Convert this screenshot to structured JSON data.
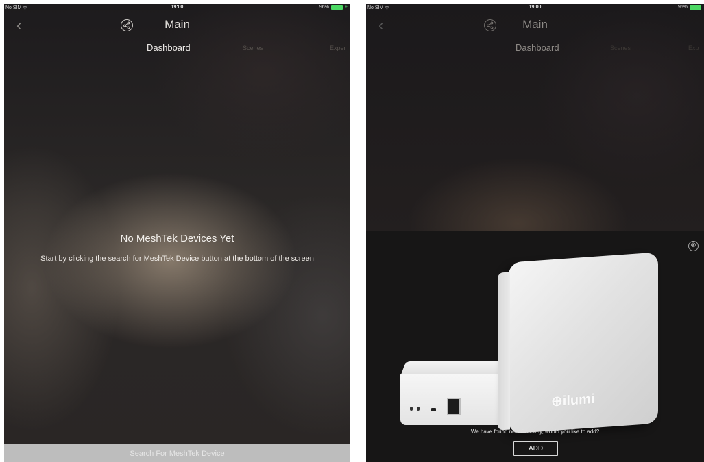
{
  "left": {
    "status": {
      "carrier": "No SIM ᯤ",
      "time": "19:00",
      "battery": "96%"
    },
    "title": "Main",
    "tabs": [
      "Dashboard",
      "Scenes",
      "Exper"
    ],
    "empty_title": "No MeshTek Devices Yet",
    "empty_desc": "Start by clicking the search for MeshTek Device button at the bottom of the screen",
    "bottom_button": "Search For MeshTek Device"
  },
  "right": {
    "status": {
      "carrier": "No SIM ᯤ",
      "time": "19:00",
      "battery": "96%"
    },
    "title": "Main",
    "tabs": [
      "Dashboard",
      "Scenes",
      "Exp"
    ],
    "panel": {
      "close": "⊗",
      "logo": "⊕ilumi",
      "message": "We have found new Gateway, would you like to add?",
      "add_label": "ADD"
    }
  },
  "colors": {
    "battery": "#4cd964",
    "bottom_button_bg": "#bdbdbd",
    "panel_bg": "#171616"
  },
  "icons": [
    "back-chevron-icon",
    "share-icon",
    "close-circle-icon"
  ]
}
